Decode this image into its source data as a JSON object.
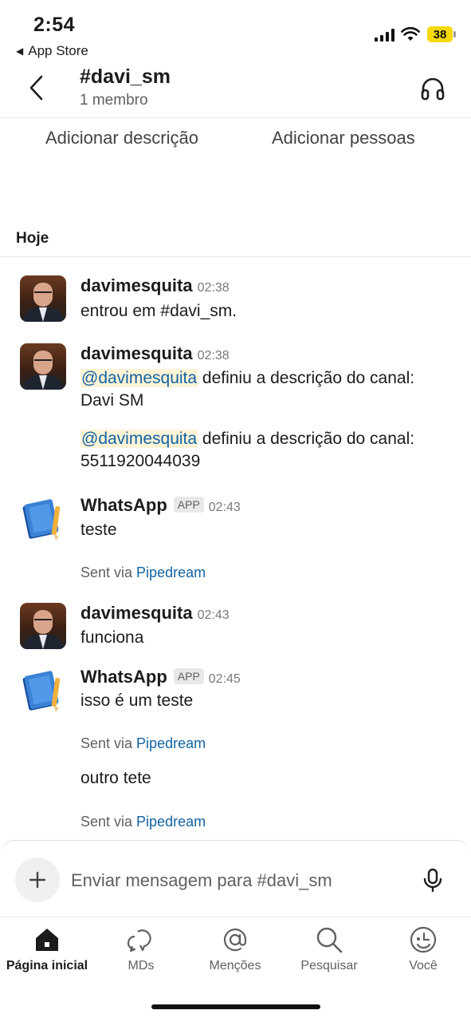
{
  "status_bar": {
    "time": "2:54",
    "back_app": "App Store",
    "battery": "38"
  },
  "header": {
    "channel_name": "#davi_sm",
    "member_count": "1 membro"
  },
  "actions": {
    "add_description": "Adicionar descrição",
    "add_people": "Adicionar pessoas"
  },
  "day_divider": "Hoje",
  "messages": [
    {
      "author": "davimesquita",
      "time": "02:38",
      "text": "entrou em #davi_sm."
    },
    {
      "author": "davimesquita",
      "time": "02:38",
      "mention1": "@davimesquita",
      "text1a": " definiu a descrição do canal:",
      "text1b": "Davi SM",
      "mention2": "@davimesquita",
      "text2a": " definiu a descrição do canal:",
      "text2b": "5511920044039"
    },
    {
      "author": "WhatsApp",
      "badge": "APP",
      "time": "02:43",
      "text": "teste",
      "meta_prefix": "Sent via ",
      "meta_link": "Pipedream"
    },
    {
      "author": "davimesquita",
      "time": "02:43",
      "text": "funciona"
    },
    {
      "author": "WhatsApp",
      "badge": "APP",
      "time": "02:45",
      "text": "isso é um teste",
      "meta_prefix": "Sent via ",
      "meta_link": "Pipedream",
      "text2": "outro tete",
      "meta2_prefix": "Sent via ",
      "meta2_link": "Pipedream"
    }
  ],
  "composer": {
    "placeholder": "Enviar mensagem para #davi_sm"
  },
  "tabs": [
    {
      "label": "Página inicial",
      "icon": "home-icon",
      "active": true
    },
    {
      "label": "MDs",
      "icon": "chat-bubbles-icon",
      "active": false
    },
    {
      "label": "Menções",
      "icon": "at-icon",
      "active": false
    },
    {
      "label": "Pesquisar",
      "icon": "search-icon",
      "active": false
    },
    {
      "label": "Você",
      "icon": "profile-icon",
      "active": false
    }
  ],
  "colors": {
    "mention_bg": "#fdf3d7",
    "link": "#1264a3",
    "battery": "#f5d90a"
  }
}
